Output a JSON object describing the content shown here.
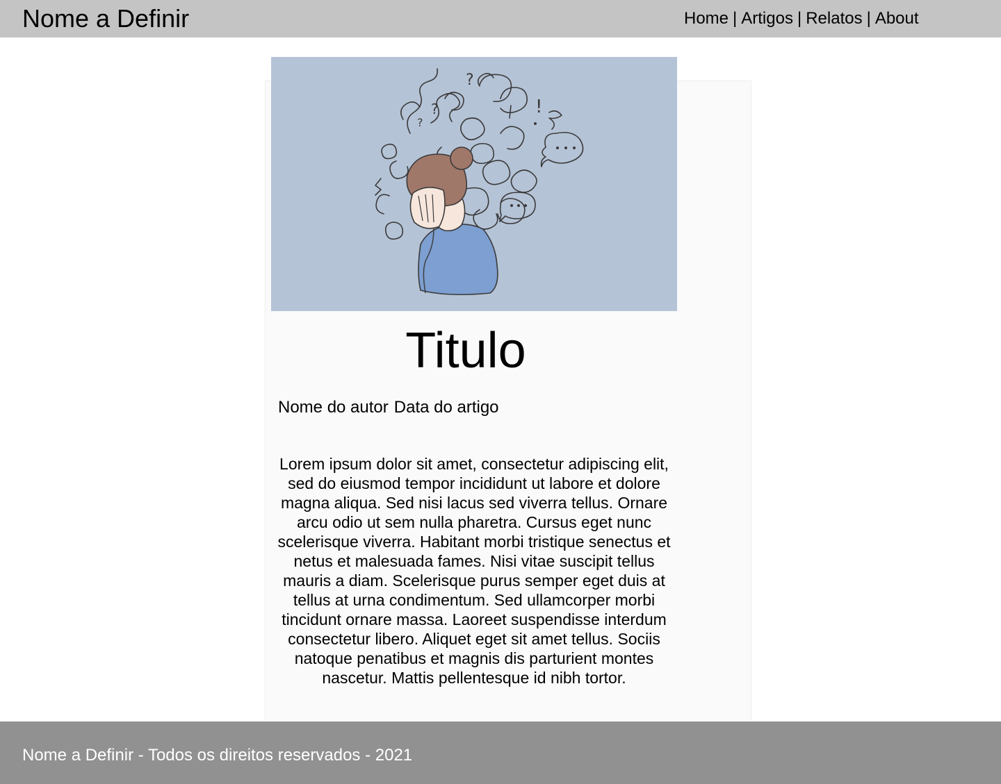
{
  "header": {
    "brand": "Nome a Definir",
    "nav": [
      {
        "label": "Home"
      },
      {
        "label": "Artigos"
      },
      {
        "label": "Relatos"
      },
      {
        "label": "About"
      }
    ],
    "separator": "|"
  },
  "article": {
    "image_icon": "anxious-woman-illustration",
    "title": "Titulo",
    "author": "Nome do autor",
    "date": "Data do artigo",
    "body": "Lorem ipsum dolor sit amet, consectetur adipiscing elit, sed do eiusmod tempor incididunt ut labore et dolore magna aliqua. Sed nisi lacus sed viverra tellus. Ornare arcu odio ut sem nulla pharetra. Cursus eget nunc scelerisque viverra. Habitant morbi tristique senectus et netus et malesuada fames. Nisi vitae suscipit tellus mauris a diam. Scelerisque purus semper eget duis at tellus at urna condimentum. Sed ullamcorper morbi tincidunt ornare massa. Laoreet suspendisse interdum consectetur libero. Aliquet eget sit amet tellus. Sociis natoque penatibus et magnis dis parturient montes nascetur. Mattis pellentesque id nibh tortor."
  },
  "footer": {
    "text": "Nome a Definir - Todos os direitos reservados - 2021"
  },
  "colors": {
    "topbar": "#c4c4c4",
    "footer": "#919191",
    "hero_background": "#b5c3d6",
    "card_background": "#fafafa"
  }
}
